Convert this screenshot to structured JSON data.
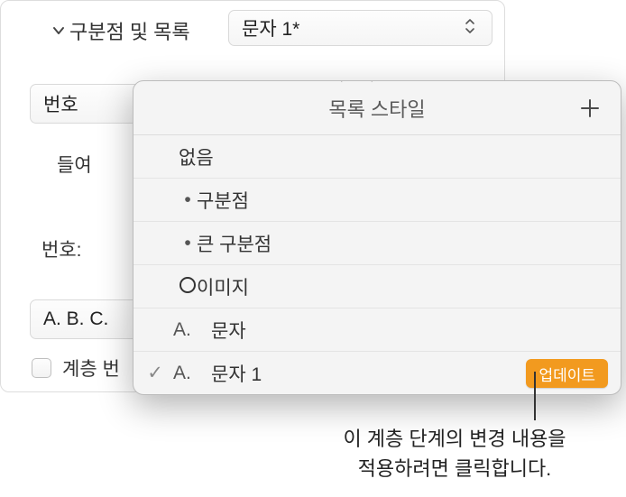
{
  "section": {
    "title": "구분점 및 목록"
  },
  "selector": {
    "value": "문자 1*"
  },
  "numberLabel": "번호",
  "indentLabel": "들여",
  "numberingLabel": "번호:",
  "formatBgText": "A. B. C.",
  "hierLabel": "계층 번",
  "popover": {
    "title": "목록 스타일",
    "items": {
      "none": {
        "label": "없음"
      },
      "bullet": {
        "mark": "•",
        "label": "구분점"
      },
      "bigBullet": {
        "mark": "•",
        "label": "큰 구분점"
      },
      "image": {
        "label": "이미지"
      },
      "letter": {
        "prefix": "A.",
        "label": "문자"
      },
      "letter1": {
        "check": "✓",
        "prefix": "A.",
        "label": "문자 1",
        "updateLabel": "업데이트"
      }
    }
  },
  "callout": {
    "line1": "이 계층 단계의 변경 내용을",
    "line2": "적용하려면 클릭합니다."
  }
}
